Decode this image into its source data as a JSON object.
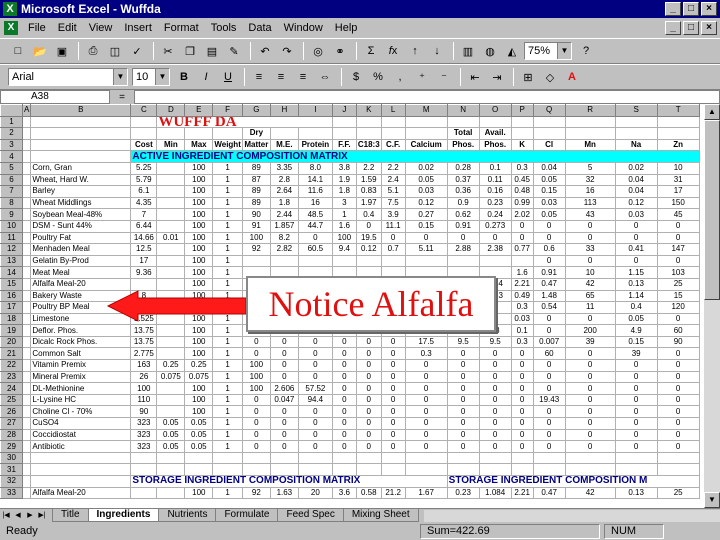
{
  "window": {
    "title": "Microsoft Excel - Wuffda",
    "app_glyph": "X"
  },
  "menu": [
    "File",
    "Edit",
    "View",
    "Insert",
    "Format",
    "Tools",
    "Data",
    "Window",
    "Help"
  ],
  "toolbar": {
    "zoom": "75%",
    "font": "Arial",
    "font_size": "10"
  },
  "formula": {
    "cell_ref": "A38",
    "content": ""
  },
  "sheet": {
    "title_text": "WUFFF DA",
    "columns": [
      "A",
      "B",
      "C",
      "D",
      "E",
      "F",
      "G",
      "H",
      "I",
      "J",
      "K",
      "L",
      "M",
      "N",
      "O",
      "P",
      "Q",
      "R",
      "S",
      "T"
    ],
    "header2": [
      "",
      "",
      "",
      "",
      "",
      "",
      "Dry",
      "",
      "",
      "",
      "",
      "",
      "",
      "Total",
      "Avail.",
      "",
      "",
      "",
      "",
      ""
    ],
    "header3": [
      "",
      "",
      "Cost",
      "Min",
      "Max",
      "Weight",
      "Matter",
      "M.E.",
      "Protein",
      "F.F.",
      "C18:3",
      "C.F.",
      "Calcium",
      "Phos.",
      "Phos.",
      "K",
      "Cl",
      "Mn",
      "Na",
      "Zn"
    ],
    "section1": "ACTIVE INGREDIENT COMPOSITION MATRIX",
    "section2a": "STORAGE INGREDIENT COMPOSITION MATRIX",
    "section2b": "STORAGE INGREDIENT COMPOSITION M",
    "rows": [
      {
        "num": "5",
        "c": [
          "Corn, Gran",
          "5.25",
          "",
          "100",
          "1",
          "89",
          "3.35",
          "8.0",
          "3.8",
          "2.2",
          "2.2",
          "0.02",
          "0.28",
          "0.1",
          "0.3",
          "0.04",
          "5",
          "0.02",
          "10"
        ]
      },
      {
        "num": "6",
        "c": [
          "Wheat, Hard W.",
          "5.79",
          "",
          "100",
          "1",
          "87",
          "2.8",
          "14.1",
          "1.9",
          "1.59",
          "2.4",
          "0.05",
          "0.37",
          "0.11",
          "0.45",
          "0.05",
          "32",
          "0.04",
          "31"
        ]
      },
      {
        "num": "7",
        "c": [
          "Barley",
          "6.1",
          "",
          "100",
          "1",
          "89",
          "2.64",
          "11.6",
          "1.8",
          "0.83",
          "5.1",
          "0.03",
          "0.36",
          "0.16",
          "0.48",
          "0.15",
          "16",
          "0.04",
          "17"
        ]
      },
      {
        "num": "8",
        "c": [
          "Wheat Middlings",
          "4.35",
          "",
          "100",
          "1",
          "89",
          "1.8",
          "16",
          "3",
          "1.97",
          "7.5",
          "0.12",
          "0.9",
          "0.23",
          "0.99",
          "0.03",
          "113",
          "0.12",
          "150"
        ]
      },
      {
        "num": "9",
        "c": [
          "Soybean Meal-48%",
          "7",
          "",
          "100",
          "1",
          "90",
          "2.44",
          "48.5",
          "1",
          "0.4",
          "3.9",
          "0.27",
          "0.62",
          "0.24",
          "2.02",
          "0.05",
          "43",
          "0.03",
          "45"
        ]
      },
      {
        "num": "10",
        "c": [
          "DSM - Sunt 44%",
          "6.44",
          "",
          "100",
          "1",
          "91",
          "1.857",
          "44.7",
          "1.6",
          "0",
          "11.1",
          "0.15",
          "0.91",
          "0.273",
          "0",
          "0",
          "0",
          "0",
          "0"
        ]
      },
      {
        "num": "11",
        "c": [
          "Poultry Fat",
          "14.66",
          "0.01",
          "100",
          "1",
          "100",
          "8.2",
          "0",
          "100",
          "19.5",
          "0",
          "0",
          "0",
          "0",
          "0",
          "0",
          "0",
          "0",
          "0"
        ]
      },
      {
        "num": "12",
        "c": [
          "Menhaden Meal",
          "12.5",
          "",
          "100",
          "1",
          "92",
          "2.82",
          "60.5",
          "9.4",
          "0.12",
          "0.7",
          "5.11",
          "2.88",
          "2.38",
          "0.77",
          "0.6",
          "33",
          "0.41",
          "147"
        ]
      },
      {
        "num": "13",
        "c": [
          "Gelatin By-Prod",
          "17",
          "",
          "100",
          "1",
          "",
          "",
          "",
          "",
          "",
          "",
          "",
          "",
          "",
          "",
          "0",
          "0",
          "0",
          "0"
        ]
      },
      {
        "num": "14",
        "c": [
          "Meat Meal",
          "9.36",
          "",
          "100",
          "1",
          "",
          "",
          "",
          "",
          "",
          "",
          "",
          "",
          "",
          "1.6",
          "0.91",
          "10",
          "1.15",
          "103"
        ]
      },
      {
        "num": "15",
        "c": [
          "Alfalfa Meal-20",
          "",
          "",
          "100",
          "1",
          "",
          "",
          "",
          "",
          "",
          "",
          "",
          "",
          "0.34",
          "2.21",
          "0.47",
          "42",
          "0.13",
          "25"
        ]
      },
      {
        "num": "16",
        "c": [
          "Bakery Waste",
          "8",
          "",
          "100",
          "1",
          "",
          "",
          "",
          "",
          "",
          "",
          "",
          "",
          "0.13",
          "0.49",
          "1.48",
          "65",
          "1.14",
          "15"
        ]
      },
      {
        "num": "17",
        "c": [
          "Poultry BP Meal",
          "10",
          "",
          "100",
          "1",
          "",
          "",
          "",
          "",
          "",
          "",
          "",
          "",
          "",
          "0.3",
          "0.54",
          "11",
          "0.4",
          "120"
        ]
      },
      {
        "num": "18",
        "c": [
          "Limestone",
          "1.525",
          "",
          "100",
          "1",
          "",
          "",
          "",
          "",
          "",
          "",
          "",
          "",
          "",
          "0.03",
          "0",
          "0",
          "0.05",
          "0"
        ]
      },
      {
        "num": "19",
        "c": [
          "Deflor. Phos.",
          "13.75",
          "",
          "100",
          "1",
          "0",
          "0",
          "0",
          "0",
          "0",
          "0",
          "32",
          "18",
          "18",
          "0.1",
          "0",
          "200",
          "4.9",
          "60"
        ]
      },
      {
        "num": "20",
        "c": [
          "Dicalc Rock Phos.",
          "13.75",
          "",
          "100",
          "1",
          "0",
          "0",
          "0",
          "0",
          "0",
          "0",
          "17.5",
          "9.5",
          "9.5",
          "0.3",
          "0.007",
          "39",
          "0.15",
          "90"
        ]
      },
      {
        "num": "21",
        "c": [
          "Common Salt",
          "2.775",
          "",
          "100",
          "1",
          "0",
          "0",
          "0",
          "0",
          "0",
          "0",
          "0.3",
          "0",
          "0",
          "0",
          "60",
          "0",
          "39",
          "0"
        ]
      },
      {
        "num": "22",
        "c": [
          "Vitamin Premix",
          "163",
          "0.25",
          "0.25",
          "1",
          "100",
          "0",
          "0",
          "0",
          "0",
          "0",
          "0",
          "0",
          "0",
          "0",
          "0",
          "0",
          "0",
          "0"
        ]
      },
      {
        "num": "23",
        "c": [
          "Mineral Premix",
          "26",
          "0.075",
          "0.075",
          "1",
          "100",
          "0",
          "0",
          "0",
          "0",
          "0",
          "0",
          "0",
          "0",
          "0",
          "0",
          "0",
          "0",
          "0"
        ]
      },
      {
        "num": "24",
        "c": [
          "DL-Methionine",
          "100",
          "",
          "100",
          "1",
          "100",
          "2.606",
          "57.52",
          "0",
          "0",
          "0",
          "0",
          "0",
          "0",
          "0",
          "0",
          "0",
          "0",
          "0"
        ]
      },
      {
        "num": "25",
        "c": [
          "L-Lysine HC",
          "110",
          "",
          "100",
          "1",
          "0",
          "0.047",
          "94.4",
          "0",
          "0",
          "0",
          "0",
          "0",
          "0",
          "0",
          "19.43",
          "0",
          "0",
          "0"
        ]
      },
      {
        "num": "26",
        "c": [
          "Choline Cl - 70%",
          "90",
          "",
          "100",
          "1",
          "0",
          "0",
          "0",
          "0",
          "0",
          "0",
          "0",
          "0",
          "0",
          "0",
          "0",
          "0",
          "0",
          "0"
        ]
      },
      {
        "num": "27",
        "c": [
          "CuSO4",
          "323",
          "0.05",
          "0.05",
          "1",
          "0",
          "0",
          "0",
          "0",
          "0",
          "0",
          "0",
          "0",
          "0",
          "0",
          "0",
          "0",
          "0",
          "0"
        ]
      },
      {
        "num": "28",
        "c": [
          "Coccidiostat",
          "323",
          "0.05",
          "0.05",
          "1",
          "0",
          "0",
          "0",
          "0",
          "0",
          "0",
          "0",
          "0",
          "0",
          "0",
          "0",
          "0",
          "0",
          "0"
        ]
      },
      {
        "num": "29",
        "c": [
          "Antibiotic",
          "323",
          "0.05",
          "0.05",
          "1",
          "0",
          "0",
          "0",
          "0",
          "0",
          "0",
          "0",
          "0",
          "0",
          "0",
          "0",
          "0",
          "0",
          "0"
        ]
      }
    ],
    "row33": {
      "num": "33",
      "c": [
        "Alfalfa Meal-20",
        "",
        "",
        "100",
        "1",
        "92",
        "1.63",
        "20",
        "3.6",
        "0.58",
        "21.2",
        "1.67",
        "0.23",
        "1.084",
        "2.21",
        "0.47",
        "42",
        "0.13",
        "25"
      ]
    }
  },
  "tabs": [
    "Title",
    "Ingredients",
    "Nutrients",
    "Formulate",
    "Feed Spec",
    "Mixing Sheet"
  ],
  "active_tab": "Ingredients",
  "status": {
    "left": "Ready",
    "sum": "Sum=422.69",
    "num": "NUM"
  },
  "callout": {
    "text": "Notice Alfalfa"
  },
  "colors": {
    "title_red": "#e01010",
    "section_blue": "#000080",
    "active_band": "#00ffff",
    "titlebar": "#000080"
  }
}
